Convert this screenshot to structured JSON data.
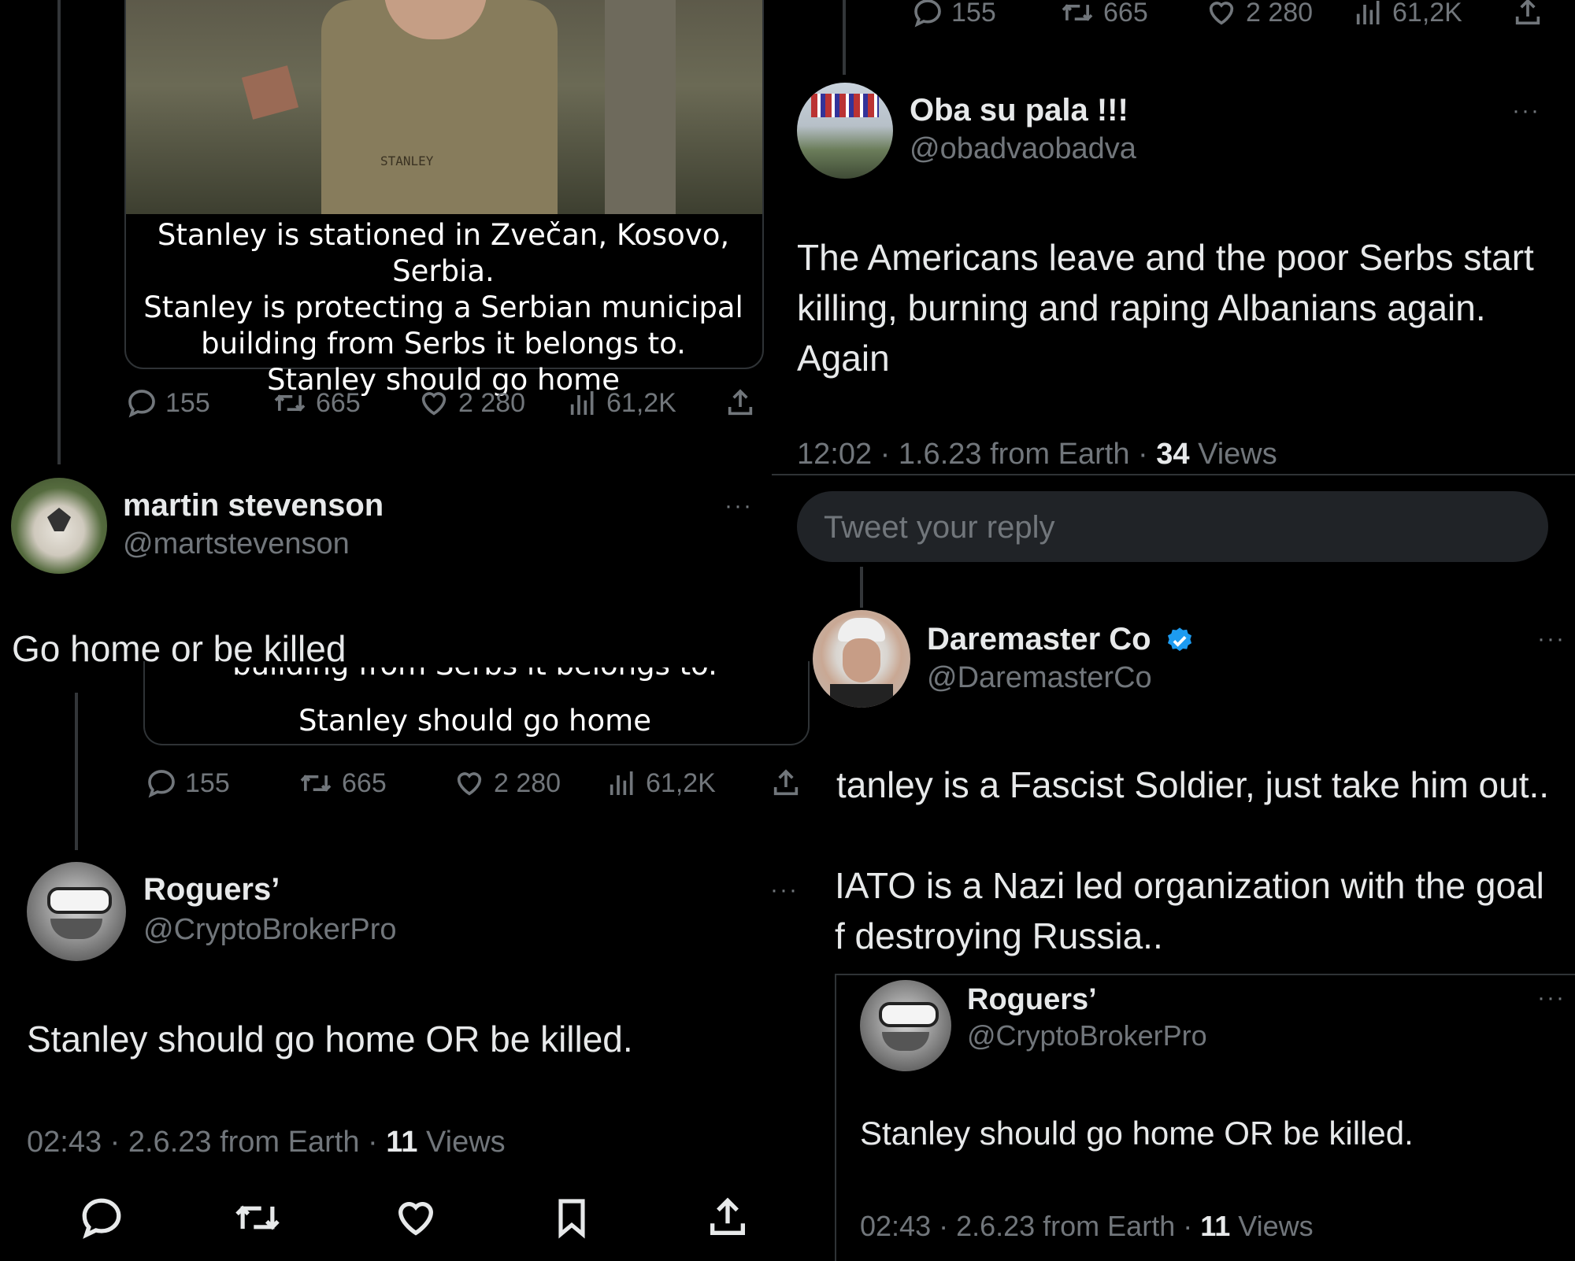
{
  "colors": {
    "background": "#000000",
    "text": "#e7e9ea",
    "muted": "#71767b",
    "verified": "#1d9bf0",
    "divider": "#2f3336"
  },
  "top_right_stats": {
    "replies": "155",
    "retweets": "665",
    "likes": "2 280",
    "views": "61,2K"
  },
  "quoted_caption": {
    "lines": [
      "Stanley is stationed in Zvečan, Kosovo, Serbia.",
      "Stanley is protecting a Serbian municipal",
      "building from Serbs it belongs to.",
      "Stanley should go home"
    ],
    "image_text": "STANLEY"
  },
  "left_stats_1": {
    "replies": "155",
    "retweets": "665",
    "likes": "2 280",
    "views": "61,2K"
  },
  "martin": {
    "name": "martin stevenson",
    "handle": "@martstevenson",
    "text": "Go home or be killed",
    "more": "···"
  },
  "caption_fragment": {
    "partial": "building from Serbs it belongs to.",
    "last": "Stanley should go home"
  },
  "left_stats_2": {
    "replies": "155",
    "retweets": "665",
    "likes": "2 280",
    "views": "61,2K"
  },
  "roguers_left": {
    "name": "Roguers’",
    "handle": "@CryptoBrokerPro",
    "text": "Stanley should go home OR be killed.",
    "time": "02:43 · 2.6.23 from Earth · ",
    "views_count": "11",
    "views_label": " Views",
    "more": "···"
  },
  "obasu": {
    "name": "Oba su pala !!!",
    "handle": "@obadvaobadva",
    "lines": [
      "The Americans leave and the poor Serbs start",
      "killing, burning and raping Albanians again.",
      "Again"
    ],
    "time": "12:02 · 1.6.23 from Earth · ",
    "views_count": "34",
    "views_label": " Views",
    "more": "···"
  },
  "reply_box": {
    "placeholder": "Tweet your reply"
  },
  "daremaster": {
    "name": "Daremaster Co",
    "handle": "@DaremasterCo",
    "lines": [
      "tanley is a Fascist Soldier, just take him out..",
      "",
      "IATO is a Nazi led organization with the goal",
      "f destroying Russia.."
    ],
    "more": "···"
  },
  "roguers_right": {
    "name": "Roguers’",
    "handle": "@CryptoBrokerPro",
    "text": "Stanley should go home OR be killed.",
    "time": "02:43 · 2.6.23 from Earth · ",
    "views_count": "11",
    "views_label": " Views",
    "more": "···"
  }
}
